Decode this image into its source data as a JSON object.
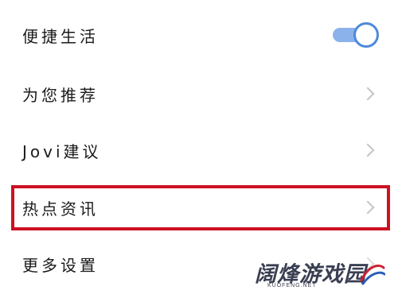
{
  "settings": {
    "items": [
      {
        "label": "便捷生活",
        "control": "toggle",
        "toggle_on": true
      },
      {
        "label": "为您推荐",
        "control": "chevron"
      },
      {
        "label": "Jovi建议",
        "control": "chevron"
      },
      {
        "label": "热点资讯",
        "control": "chevron",
        "highlighted": true
      },
      {
        "label": "更多设置",
        "control": "chevron"
      }
    ]
  },
  "watermark": {
    "title": "阔烽游戏园",
    "site": "KUOFENG.NET"
  },
  "colors": {
    "highlight": "#cc1122",
    "toggle_track": "#8bb2ea",
    "toggle_knob_border": "#4d89db",
    "chevron": "#c4c4c4",
    "text": "#1a1a1a"
  }
}
